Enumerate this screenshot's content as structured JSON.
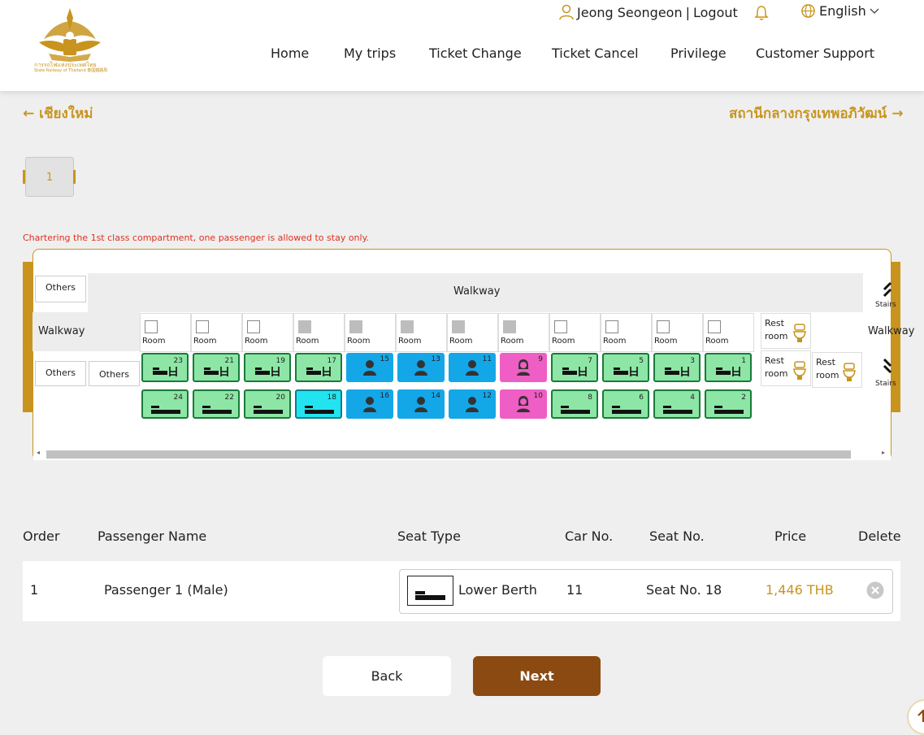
{
  "header": {
    "logo_text_th": "การรถไฟแห่งประเทศไทย",
    "logo_text_en": "State Railway of Thailand 泰國鐵路局",
    "user_name": "Jeong Seongeon",
    "separator": "|",
    "logout": "Logout",
    "language": "English",
    "nav": [
      "Home",
      "My trips",
      "Ticket Change",
      "Ticket Cancel",
      "Privilege",
      "Customer Support"
    ]
  },
  "route": {
    "origin": "เชียงใหม่",
    "destination": "สถานีกลางกรุงเทพอภิวัฒน์"
  },
  "car_page": "1",
  "warning": "Chartering the 1st class compartment, one passenger is allowed to stay only.",
  "seatmap": {
    "walkway_label": "Walkway",
    "others_label": "Others",
    "room_label": "Room",
    "restroom_label": "Rest room",
    "stairs_label": "Stairs",
    "walkway_right_label": "Walkway",
    "rooms": [
      {
        "filled": false
      },
      {
        "filled": false
      },
      {
        "filled": false
      },
      {
        "filled": true
      },
      {
        "filled": true
      },
      {
        "filled": true
      },
      {
        "filled": true
      },
      {
        "filled": true
      },
      {
        "filled": false
      },
      {
        "filled": false
      },
      {
        "filled": false
      },
      {
        "filled": false
      }
    ],
    "upper_row": [
      {
        "num": "23",
        "status": "green"
      },
      {
        "num": "21",
        "status": "green"
      },
      {
        "num": "19",
        "status": "green"
      },
      {
        "num": "17",
        "status": "green"
      },
      {
        "num": "15",
        "status": "blue"
      },
      {
        "num": "13",
        "status": "blue"
      },
      {
        "num": "11",
        "status": "blue"
      },
      {
        "num": "9",
        "status": "pink"
      },
      {
        "num": "7",
        "status": "green"
      },
      {
        "num": "5",
        "status": "green"
      },
      {
        "num": "3",
        "status": "green"
      },
      {
        "num": "1",
        "status": "green"
      }
    ],
    "lower_row": [
      {
        "num": "24",
        "status": "green"
      },
      {
        "num": "22",
        "status": "green"
      },
      {
        "num": "20",
        "status": "green"
      },
      {
        "num": "18",
        "status": "cyan"
      },
      {
        "num": "16",
        "status": "blue"
      },
      {
        "num": "14",
        "status": "blue"
      },
      {
        "num": "12",
        "status": "blue"
      },
      {
        "num": "10",
        "status": "pink"
      },
      {
        "num": "8",
        "status": "green"
      },
      {
        "num": "6",
        "status": "green"
      },
      {
        "num": "4",
        "status": "green"
      },
      {
        "num": "2",
        "status": "green"
      }
    ]
  },
  "table": {
    "headers": [
      "Order",
      "Passenger Name",
      "Seat Type",
      "Car No.",
      "Seat No.",
      "Price",
      "Delete"
    ],
    "rows": [
      {
        "order": "1",
        "name": "Passenger 1 (Male)",
        "seat_type": "Lower Berth",
        "car": "11",
        "seat": "Seat No. 18",
        "price": "1,446 THB"
      }
    ]
  },
  "buttons": {
    "back": "Back",
    "next": "Next"
  },
  "colors": {
    "accent": "#c8941e",
    "next_button": "#8a4a12",
    "warning": "#e0301e"
  }
}
